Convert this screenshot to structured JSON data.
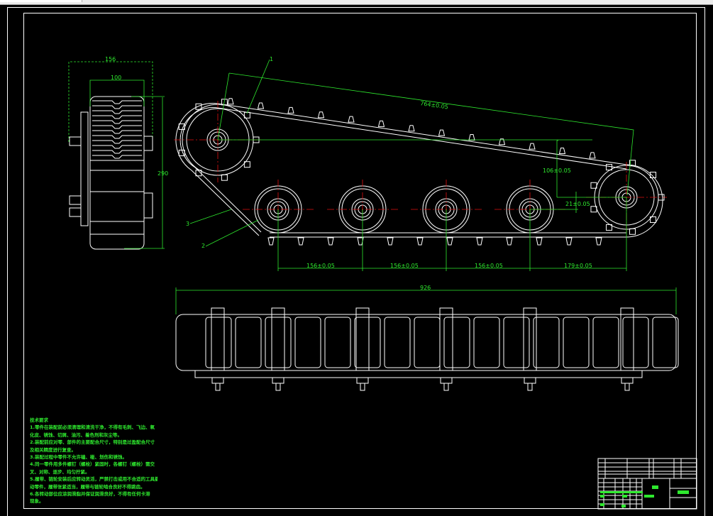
{
  "drawing": {
    "side_view": {
      "dims": {
        "outer_width": "156",
        "track_width": "100",
        "height": "290"
      }
    },
    "main_view": {
      "dims": {
        "center_distance": "764±0.05",
        "vertical_offset": "106±0.05",
        "wheel_offset": "21±0.05",
        "wheel_spacing": [
          "156±0.05",
          "156±0.05",
          "156±0.05",
          "179±0.05"
        ]
      },
      "part_labels": [
        "1",
        "2",
        "3"
      ]
    },
    "bottom_view": {
      "dims": {
        "overall_length": "926"
      }
    },
    "technical_notes": {
      "title": "技术要求",
      "lines": [
        "1.零件在装配前必须清理和清洗干净，不得有毛刺、飞边、氧",
        "化皮、锈蚀、切屑、油污、着色剂和灰尘等。",
        "2.装配前应对零、部件的主要配合尺寸，特别是过盈配合尺寸",
        "及相关精度进行复查。",
        "3.装配过程中零件不允许磕、碰、划伤和锈蚀。",
        "4.同一零件用多件螺钉（螺栓）紧固时，各螺钉（螺栓）需交",
        "叉、对称、逐步、均匀拧紧。",
        "5.履带、链轮安装后应转动灵活，严禁打击或用不合适的工具撬",
        "动零件，履带张紧适当，履带与链轮啮合良好不得跳齿。",
        "6.各转动部位应涂润滑脂并保证润滑良好，不得有任何卡滞",
        "现象。"
      ]
    },
    "colors": {
      "background": "#000000",
      "geometry": "#ffffff",
      "dimensions": "#2ee82e",
      "centerlines": "#e01010"
    }
  }
}
